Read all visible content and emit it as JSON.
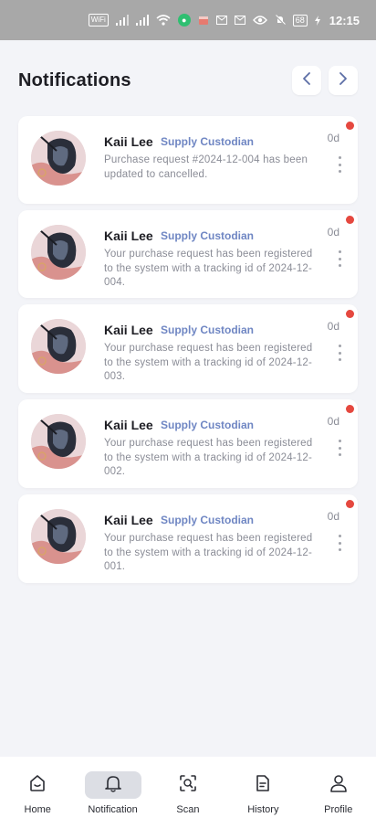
{
  "status_bar": {
    "wifi_badge": "WiFi",
    "battery": "68",
    "time": "12:15"
  },
  "header": {
    "title": "Notifications"
  },
  "notifications": [
    {
      "name": "Kaii Lee",
      "role": "Supply Custodian",
      "message": "Purchase request #2024-12-004 has been updated to cancelled.",
      "time": "0d",
      "unread": true
    },
    {
      "name": "Kaii Lee",
      "role": "Supply Custodian",
      "message": "Your purchase request has been registered to the system with a tracking id of 2024-12-004.",
      "time": "0d",
      "unread": true
    },
    {
      "name": "Kaii Lee",
      "role": "Supply Custodian",
      "message": "Your purchase request has been registered to the system with a tracking id of 2024-12-003.",
      "time": "0d",
      "unread": true
    },
    {
      "name": "Kaii Lee",
      "role": "Supply Custodian",
      "message": "Your purchase request has been registered to the system with a tracking id of 2024-12-002.",
      "time": "0d",
      "unread": true
    },
    {
      "name": "Kaii Lee",
      "role": "Supply Custodian",
      "message": "Your purchase request has been registered to the system with a tracking id of 2024-12-001.",
      "time": "0d",
      "unread": true
    }
  ],
  "bottom_nav": {
    "items": [
      {
        "label": "Home",
        "icon": "home-icon",
        "active": false
      },
      {
        "label": "Notification",
        "icon": "bell-icon",
        "active": true
      },
      {
        "label": "Scan",
        "icon": "scan-icon",
        "active": false
      },
      {
        "label": "History",
        "icon": "document-icon",
        "active": false
      },
      {
        "label": "Profile",
        "icon": "user-icon",
        "active": false
      }
    ]
  },
  "colors": {
    "accent_role": "#6f86c3",
    "unread_dot": "#e5483f",
    "background": "#f3f4f8",
    "active_tab_bg": "#dcdee4"
  }
}
